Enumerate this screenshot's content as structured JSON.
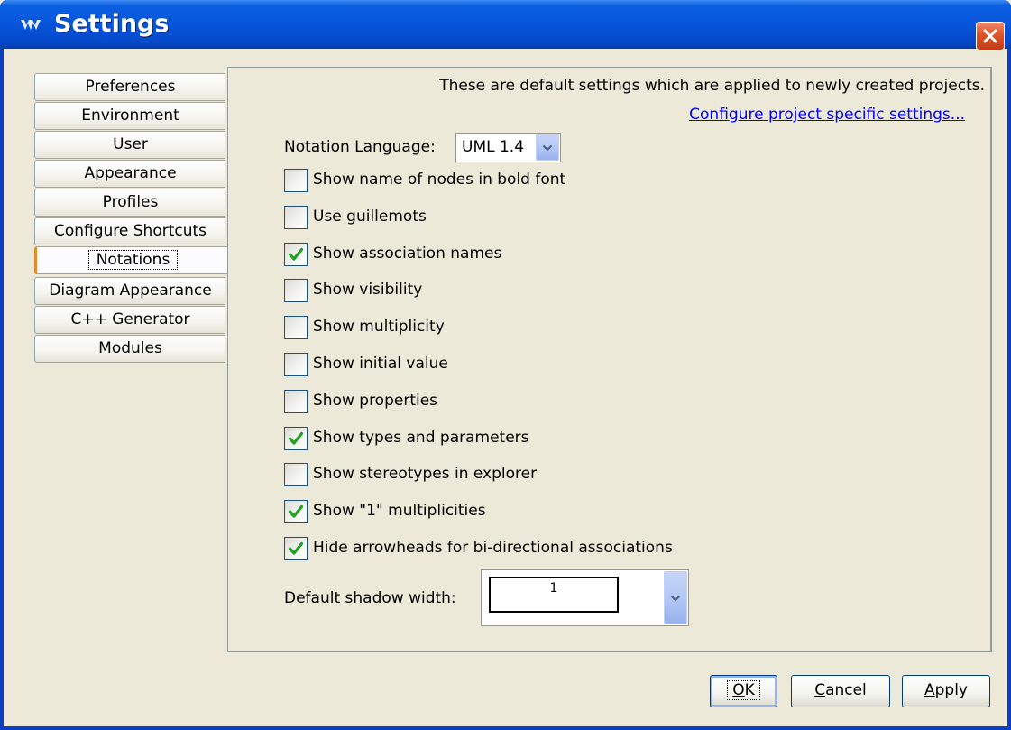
{
  "window": {
    "title": "Settings",
    "icon": "argo-icon",
    "close_icon": "close-icon"
  },
  "tabs": [
    {
      "label": "Preferences",
      "selected": false
    },
    {
      "label": "Environment",
      "selected": false
    },
    {
      "label": "User",
      "selected": false
    },
    {
      "label": "Appearance",
      "selected": false
    },
    {
      "label": "Profiles",
      "selected": false
    },
    {
      "label": "Configure Shortcuts",
      "selected": false
    },
    {
      "label": "Notations",
      "selected": true
    },
    {
      "label": "Diagram Appearance",
      "selected": false
    },
    {
      "label": "C++ Generator",
      "selected": false
    },
    {
      "label": "Modules",
      "selected": false
    }
  ],
  "panel": {
    "info_text": "These are default settings which are applied to newly created projects.",
    "config_link": "Configure project specific settings...",
    "notation_label": "Notation Language:",
    "notation_value": "UML 1.4",
    "checkboxes": [
      {
        "label": "Show name of nodes in bold font",
        "checked": false
      },
      {
        "label": "Use guillemots",
        "checked": false
      },
      {
        "label": "Show association names",
        "checked": true
      },
      {
        "label": "Show visibility",
        "checked": false
      },
      {
        "label": "Show multiplicity",
        "checked": false
      },
      {
        "label": "Show initial value",
        "checked": false
      },
      {
        "label": "Show properties",
        "checked": false
      },
      {
        "label": "Show types and parameters",
        "checked": true
      },
      {
        "label": "Show stereotypes in explorer",
        "checked": false
      },
      {
        "label": "Show \"1\" multiplicities",
        "checked": true
      },
      {
        "label": "Hide arrowheads for bi-directional associations",
        "checked": true
      }
    ],
    "shadow_label": "Default shadow width:",
    "shadow_value": "1"
  },
  "buttons": {
    "ok": {
      "mnemonic": "O",
      "rest": "K"
    },
    "cancel": {
      "mnemonic": "C",
      "rest": "ancel"
    },
    "apply": {
      "mnemonic": "A",
      "rest": "pply"
    }
  },
  "colors": {
    "titlebar": "#0755dc",
    "check_mark": "#21a121",
    "link": "#0000ff",
    "selected_tab_accent": "#e68b2c"
  }
}
